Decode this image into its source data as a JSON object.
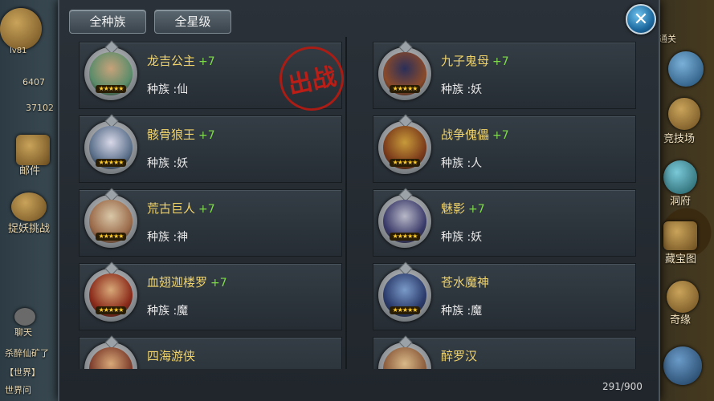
{
  "filters": {
    "race_label": "全种族",
    "star_label": "全星级"
  },
  "close_symbol": "✕",
  "stamp_text": "出战",
  "hero_count": "291/900",
  "heroes": [
    {
      "name": "龙吉公主",
      "level": "+7",
      "race": "种族 :仙",
      "stars": "★★★★★",
      "colors": [
        "#5a8c6a",
        "#c7a27a"
      ]
    },
    {
      "name": "九子鬼母",
      "level": "+7",
      "race": "种族 :妖",
      "stars": "★★★★★",
      "colors": [
        "#8a4a2a",
        "#2a2f5a"
      ]
    },
    {
      "name": "骸骨狼王",
      "level": "+7",
      "race": "种族 :妖",
      "stars": "★★★★★",
      "colors": [
        "#5a6f8a",
        "#d8d8e8"
      ]
    },
    {
      "name": "战争傀儡",
      "level": "+7",
      "race": "种族 :人",
      "stars": "★★★★★",
      "colors": [
        "#7a3a1a",
        "#c89a3a"
      ]
    },
    {
      "name": "荒古巨人",
      "level": "+7",
      "race": "种族 :神",
      "stars": "★★★★★",
      "colors": [
        "#9a6a4a",
        "#d9c8a8"
      ]
    },
    {
      "name": "魅影",
      "level": "+7",
      "race": "种族 :妖",
      "stars": "★★★★★",
      "colors": [
        "#3a3a6a",
        "#b8b8c8"
      ]
    },
    {
      "name": "血翅迦楼罗",
      "level": "+7",
      "race": "种族 :魔",
      "stars": "★★★★★",
      "colors": [
        "#8a2a1a",
        "#d8a878"
      ]
    },
    {
      "name": "苍水魔神",
      "level": "",
      "race": "种族 :魔",
      "stars": "★★★★★",
      "colors": [
        "#2a3a6a",
        "#7a9ac8"
      ]
    },
    {
      "name": "四海游侠",
      "level": "",
      "race": "",
      "stars": "",
      "colors": [
        "#7a3a2a",
        "#d8a878"
      ]
    },
    {
      "name": "醉罗汉",
      "level": "",
      "race": "",
      "stars": "",
      "colors": [
        "#8a5a3a",
        "#d8b888"
      ]
    }
  ],
  "background": {
    "left": {
      "level": "lv81",
      "coins": "6407",
      "gems": "37102",
      "mail": "邮件",
      "challenge": "捉妖挑战",
      "chat": "聊天",
      "chat_line1": "杀醉仙矿了",
      "chat_line2": "【世界】",
      "chat_line3": "世界问"
    },
    "right": {
      "pass": "通关",
      "arena": "竞技场",
      "cave": "洞府",
      "treasure": "藏宝图",
      "adventure": "奇缘"
    }
  }
}
